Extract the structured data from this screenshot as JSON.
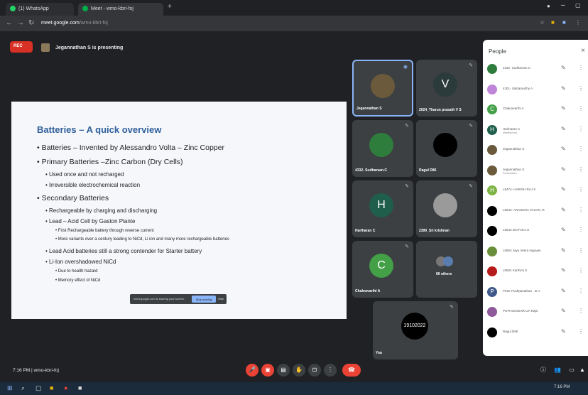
{
  "browser": {
    "tabs": [
      {
        "label": "(1) WhatsApp",
        "color": "#25d366"
      },
      {
        "label": "Meet - wmo-kbri-foj",
        "color": "#00ac47"
      }
    ],
    "url_host": "meet.google.com",
    "url_path": "/wmo-kbri-foj"
  },
  "meet": {
    "rec_label": "REC",
    "presenter_text": "Jegannathan S is presenting",
    "meeting_time": "7:16 PM",
    "meeting_code": "wmo-kbri-foj",
    "share_bar_text": "meet.google.com is sharing your screen.",
    "share_stop": "Stop sharing",
    "share_hide": "Hide"
  },
  "slide": {
    "title": "Batteries – A quick overview",
    "bullets": [
      {
        "level": 1,
        "text": "Batteries – Invented by Alessandro Volta – Zinc Copper"
      },
      {
        "level": 1,
        "text": "Primary Batteries –Zinc Carbon  (Dry Cells)"
      },
      {
        "level": 2,
        "text": "Used once and not recharged"
      },
      {
        "level": 2,
        "text": "Irreversible electrochemical reaction"
      },
      {
        "level": 1,
        "text": "Secondary Batteries"
      },
      {
        "level": 2,
        "text": "Rechargeable by charging and discharging"
      },
      {
        "level": 2,
        "text": "Lead – Acid Cell by Gaston Plante"
      },
      {
        "level": 3,
        "text": "First Rechargeable battery through reverse current"
      },
      {
        "level": 3,
        "text": "More variants over a century leading to NiCd, Li ion and many more rechargeable batteries"
      },
      {
        "level": 2,
        "text": "Lead Acid batteries still a strong contender for Starter battery"
      },
      {
        "level": 2,
        "text": "Li-Ion overshadowed NiCd"
      },
      {
        "level": 3,
        "text": "Due to health hazard"
      },
      {
        "level": 3,
        "text": "Memory effect of NiCd"
      }
    ]
  },
  "tiles": [
    {
      "name": "Jegannathan S",
      "initial": "",
      "color": "#6b5a3c"
    },
    {
      "name": "2024_Tharun prasath V S",
      "initial": "V",
      "color": "#2b3a3a"
    },
    {
      "name": "4332- Sudharsan.C",
      "initial": "",
      "color": "#2f7d3c"
    },
    {
      "name": "Ragul D86",
      "initial": "",
      "color": "#000000"
    },
    {
      "name": "Hariharan C",
      "initial": "H",
      "color": "#1e5e4a"
    },
    {
      "name": "2390_Sri krishnan",
      "initial": "",
      "color": "#9a9a9a"
    },
    {
      "name": "Chakravarthi A",
      "initial": "C",
      "color": "#43a047"
    },
    {
      "name": "66 others",
      "initial": "",
      "color": "#3c4043"
    },
    {
      "name": "You",
      "initial": "19102022",
      "color": "#000000"
    }
  ],
  "people": {
    "title": "People",
    "rows": [
      {
        "name": "4332- Sudharsan.C",
        "sub": "",
        "initial": "",
        "color": "#2f7d3c"
      },
      {
        "name": "4301- Siddamurthy A",
        "sub": "",
        "initial": "",
        "color": "#c084d8"
      },
      {
        "name": "Chakravarthi A",
        "sub": "",
        "initial": "C",
        "color": "#43a047"
      },
      {
        "name": "Hariharan C",
        "sub": "Meeting host",
        "initial": "H",
        "color": "#1e5e4a"
      },
      {
        "name": "Jegannathan S",
        "sub": "",
        "initial": "",
        "color": "#6b5a3c"
      },
      {
        "name": "Jegannathan S",
        "sub": "Presentation",
        "initial": "",
        "color": "#6b5a3c"
      },
      {
        "name": "L5474- HARISH RAJ S",
        "sub": "",
        "initial": "H",
        "color": "#7cb342"
      },
      {
        "name": "L5542- ANANDHA VASAN .R",
        "sub": "",
        "initial": "",
        "color": "#000000"
      },
      {
        "name": "L5543 DIVYAKA.S",
        "sub": "",
        "initial": "",
        "color": "#000000"
      },
      {
        "name": "L5553 Jaya Veera ragavan",
        "sub": "",
        "initial": "",
        "color": "#6a8f3a"
      },
      {
        "name": "L5504 Karthick S",
        "sub": "",
        "initial": "",
        "color": "#b71c1c"
      },
      {
        "name": "Peter Pushpanathan . D.A.",
        "sub": "",
        "initial": "P",
        "color": "#3f5a8a"
      },
      {
        "name": "POTHILINGARAJA Raja",
        "sub": "",
        "initial": "",
        "color": "#8e5a9a"
      },
      {
        "name": "Ragul D86",
        "sub": "",
        "initial": "",
        "color": "#000000"
      }
    ]
  }
}
